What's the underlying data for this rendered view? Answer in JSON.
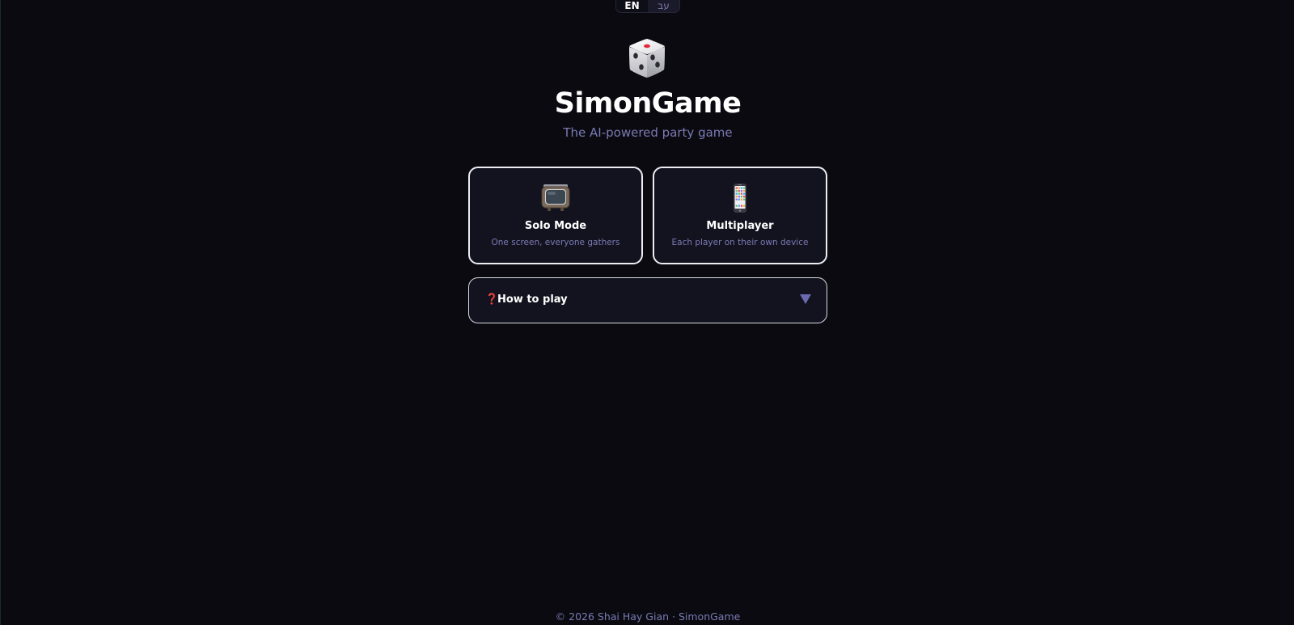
{
  "language_switch": {
    "options": [
      {
        "label": "EN",
        "active": true
      },
      {
        "label": "עב",
        "active": false
      }
    ]
  },
  "hero": {
    "icon": "dice-icon",
    "title": "SimonGame",
    "subtitle": "The AI-powered party game"
  },
  "modes": [
    {
      "icon": "tv-icon",
      "title": "Solo Mode",
      "description": "One screen, everyone gathers"
    },
    {
      "icon": "mobile-phone-icon",
      "title": "Multiplayer",
      "description": "Each player on their own device"
    }
  ],
  "how_to_play": {
    "icon": "question-mark-icon",
    "icon_glyph": "❓",
    "label": "How to play",
    "expanded": false
  },
  "footer": {
    "text": "© 2026 Shai Hay Gian · SimonGame"
  },
  "colors": {
    "background": "#0a0a10",
    "card": "#13131f",
    "accent_text": "#7a7ab4",
    "question_mark": "#e0283a"
  }
}
